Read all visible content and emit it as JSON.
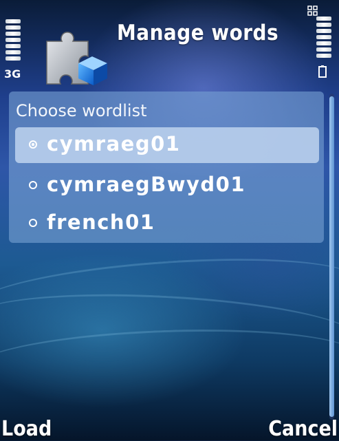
{
  "status_bar": {
    "network_label": "3G",
    "signal_icon": "signal-strength-icon",
    "battery_icon": "battery-icon",
    "menu_grid_icon": "app-grid-icon"
  },
  "header": {
    "title": "Manage words",
    "app_icon": "puzzle-piece-icon"
  },
  "wordlist": {
    "heading": "Choose wordlist",
    "options": [
      {
        "label": "cymraeg01",
        "selected": true
      },
      {
        "label": "cymraegBwyd01",
        "selected": false
      },
      {
        "label": "french01",
        "selected": false
      }
    ]
  },
  "softkeys": {
    "left": "Load",
    "right": "Cancel"
  },
  "colors": {
    "panel": "#7aa0d2",
    "highlight": "#bed4ee",
    "scrollbar": "#7fb0e2"
  }
}
